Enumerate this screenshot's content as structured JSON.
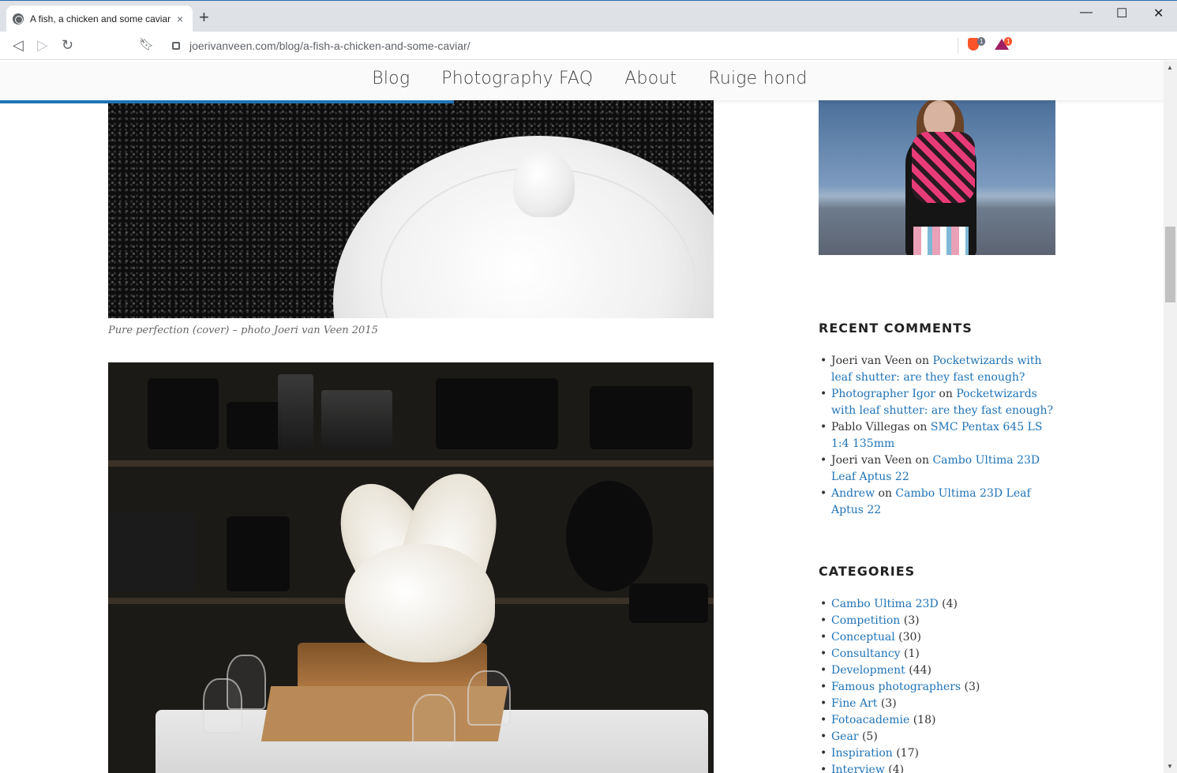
{
  "browser": {
    "tab_title": "A fish, a chicken and some caviar",
    "tab_close": "×",
    "new_tab": "+",
    "url": "joerivanveen.com/blog/a-fish-a-chicken-and-some-caviar/",
    "brave_badge": "1",
    "rewards_badge": "1",
    "controls": {
      "minimize": "—",
      "maximize": "☐",
      "close": "✕"
    }
  },
  "nav": {
    "items": [
      "Blog",
      "Photography FAQ",
      "About",
      "Ruige hond"
    ]
  },
  "reading_progress": 0.39,
  "post": {
    "caption": "Pure perfection (cover) – photo Joeri van Veen 2015"
  },
  "recent_comments": {
    "title": "RECENT COMMENTS",
    "on": "on",
    "items": [
      {
        "author": "Joeri van Veen",
        "author_link": false,
        "post": "Pocketwizards with leaf shutter: are they fast enough?"
      },
      {
        "author": "Photographer Igor",
        "author_link": true,
        "post": "Pocketwizards with leaf shutter: are they fast enough?"
      },
      {
        "author": "Pablo Villegas",
        "author_link": false,
        "post": "SMC Pentax 645 LS 1:4 135mm"
      },
      {
        "author": "Joeri van Veen",
        "author_link": false,
        "post": "Cambo Ultima 23D Leaf Aptus 22"
      },
      {
        "author": "Andrew",
        "author_link": true,
        "post": "Cambo Ultima 23D Leaf Aptus 22"
      }
    ]
  },
  "categories": {
    "title": "CATEGORIES",
    "items": [
      {
        "name": "Cambo Ultima 23D",
        "count": "(4)"
      },
      {
        "name": "Competition",
        "count": "(3)"
      },
      {
        "name": "Conceptual",
        "count": "(30)"
      },
      {
        "name": "Consultancy",
        "count": "(1)"
      },
      {
        "name": "Development",
        "count": "(44)"
      },
      {
        "name": "Famous photographers",
        "count": "(3)"
      },
      {
        "name": "Fine Art",
        "count": "(3)"
      },
      {
        "name": "Fotoacademie",
        "count": "(18)"
      },
      {
        "name": "Gear",
        "count": "(5)"
      },
      {
        "name": "Inspiration",
        "count": "(17)"
      },
      {
        "name": "Interview",
        "count": "(4)"
      }
    ]
  }
}
